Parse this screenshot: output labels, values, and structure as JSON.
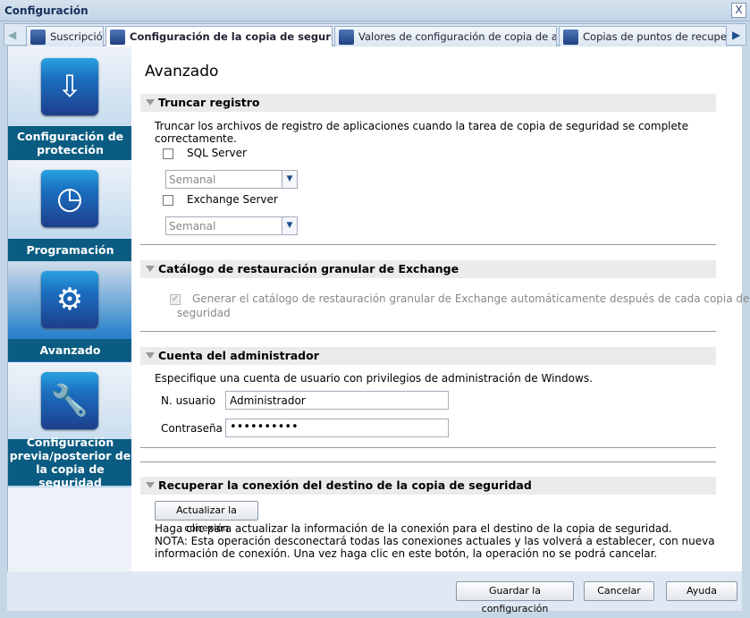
{
  "window": {
    "title": "Configuración",
    "close": "X"
  },
  "tabs": [
    {
      "label": "Suscripción"
    },
    {
      "label": "Configuración de la copia de seguridad",
      "active": true
    },
    {
      "label": "Valores de configuración de copia de archivo"
    },
    {
      "label": "Copias de puntos de recuperación"
    }
  ],
  "sidebar": {
    "items": [
      {
        "label": "Configuración de protección",
        "icon": "download-drive-icon"
      },
      {
        "label": "Programación",
        "icon": "clock-icon"
      },
      {
        "label": "Avanzado",
        "icon": "gears-icon",
        "active": true
      },
      {
        "label": "Configuración previa/posterior de la copia de seguridad",
        "icon": "wrench-icon"
      }
    ]
  },
  "main": {
    "title": "Avanzado",
    "truncate": {
      "header": "Truncar registro",
      "desc1": "Truncar los archivos de registro de aplicaciones cuando la tarea de copia de seguridad se complete",
      "desc2": "correctamente.",
      "sql_label": "SQL Server",
      "sql_checked": false,
      "sql_freq": "Semanal",
      "exch_label": "Exchange Server",
      "exch_checked": false,
      "exch_freq": "Semanal"
    },
    "catalog": {
      "header": "Catálogo de restauración granular de Exchange",
      "line1": "Generar el catálogo de restauración granular de Exchange automáticamente después de cada copia de",
      "line2": "seguridad",
      "checked": true
    },
    "admin": {
      "header": "Cuenta del administrador",
      "desc": "Especifique una cuenta de usuario con privilegios de administración de Windows.",
      "user_label": "N. usuario",
      "user_value": "Administrador",
      "pass_label": "Contraseña",
      "pass_value": "••••••••••"
    },
    "reconnect": {
      "header": "Recuperar la conexión del destino de la copia de seguridad",
      "button": "Actualizar la conexión",
      "line1": "Haga clic para actualizar la información de la conexión para el destino de la copia de seguridad.",
      "line2": "NOTA: Esta operación desconectará todas las conexiones actuales y las volverá a establecer, con nueva",
      "line3": "información de conexión. Una vez haga clic en este botón, la operación no se podrá cancelar."
    }
  },
  "footer": {
    "save": "Guardar la configuración",
    "cancel": "Cancelar",
    "help": "Ayuda"
  }
}
